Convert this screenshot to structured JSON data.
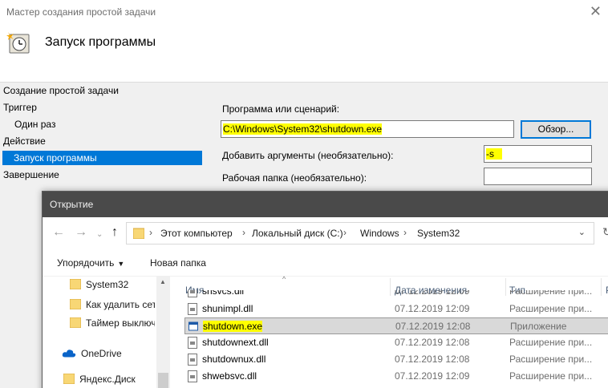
{
  "wizard": {
    "title": "Мастер создания простой задачи",
    "heading": "Запуск программы",
    "close_icon": "close-icon",
    "steps": [
      {
        "label": "Создание простой задачи",
        "level": 0,
        "selected": false
      },
      {
        "label": "Триггер",
        "level": 0,
        "selected": false
      },
      {
        "label": "Один раз",
        "level": 1,
        "selected": false
      },
      {
        "label": "Действие",
        "level": 0,
        "selected": false
      },
      {
        "label": "Запуск программы",
        "level": 1,
        "selected": true
      },
      {
        "label": "Завершение",
        "level": 0,
        "selected": false
      }
    ],
    "form": {
      "program_label": "Программа или сценарий:",
      "program_value": "C:\\Windows\\System32\\shutdown.exe",
      "browse_label": "Обзор...",
      "args_label": "Добавить аргументы (необязательно):",
      "args_value": "-s",
      "workdir_label": "Рабочая папка (необязательно):",
      "workdir_value": ""
    },
    "colors": {
      "selection": "#0078d7",
      "highlight": "#ffff00"
    }
  },
  "open_dialog": {
    "title": "Открытие",
    "breadcrumb": [
      "Этот компьютер",
      "Локальный диск (C:)",
      "Windows",
      "System32"
    ],
    "toolbar": {
      "organize_label": "Упорядочить",
      "new_folder_label": "Новая папка"
    },
    "nav_items": [
      {
        "label": "System32",
        "icon": "folder-icon"
      },
      {
        "label": "Как удалить сет",
        "icon": "folder-icon"
      },
      {
        "label": "Таймер выключ",
        "icon": "folder-icon"
      },
      {
        "label": "OneDrive",
        "icon": "cloud-icon"
      },
      {
        "label": "Яндекс.Диск",
        "icon": "folder-icon"
      }
    ],
    "columns": {
      "name": "Имя",
      "date": "Дата изменения",
      "type": "Тип",
      "size": "Р"
    },
    "files": [
      {
        "name": "shsvcs.dll",
        "date": "07.12.2019 12:09",
        "type": "Расширение при...",
        "selected": false,
        "icon": "dll-file-icon"
      },
      {
        "name": "shunimpl.dll",
        "date": "07.12.2019 12:09",
        "type": "Расширение при...",
        "selected": false,
        "icon": "dll-file-icon"
      },
      {
        "name": "shutdown.exe",
        "date": "07.12.2019 12:08",
        "type": "Приложение",
        "selected": true,
        "icon": "exe-file-icon"
      },
      {
        "name": "shutdownext.dll",
        "date": "07.12.2019 12:08",
        "type": "Расширение при...",
        "selected": false,
        "icon": "dll-file-icon"
      },
      {
        "name": "shutdownux.dll",
        "date": "07.12.2019 12:08",
        "type": "Расширение при...",
        "selected": false,
        "icon": "dll-file-icon"
      },
      {
        "name": "shwebsvc.dll",
        "date": "07.12.2019 12:09",
        "type": "Расширение при...",
        "selected": false,
        "icon": "dll-file-icon"
      }
    ]
  }
}
